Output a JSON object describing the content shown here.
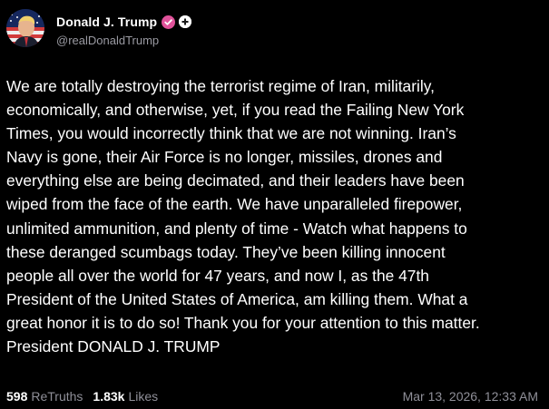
{
  "author": {
    "display_name": "Donald J. Trump",
    "handle": "@realDonaldTrump",
    "avatar_icon": "profile-avatar",
    "verified_icon": "verified-badge-icon",
    "verified_color": "#e0529a",
    "plus_icon": "plus-badge-icon"
  },
  "post": {
    "text": "We are totally destroying the terrorist regime of Iran, militarily,\neconomically, and otherwise, yet, if you read the Failing New York\nTimes, you would incorrectly think that we are not winning. Iran’s\nNavy is gone, their Air Force is no longer, missiles, drones and\neverything else are being decimated, and their leaders have been\nwiped from the face of the earth. We have unparalleled firepower,\nunlimited ammunition, and plenty of time - Watch what happens to\nthese deranged scumbags today. They’ve been killing innocent\npeople all over the world for 47 years, and now I, as the 47th\nPresident of the United States of America, am killing them. What a\ngreat honor it is to do so! Thank you for your attention to this matter.\nPresident DONALD J. TRUMP"
  },
  "stats": {
    "retruths_count": "598",
    "retruths_label": "ReTruths",
    "likes_count": "1.83k",
    "likes_label": "Likes"
  },
  "timestamp": "Mar 13, 2026, 12:33 AM",
  "colors": {
    "background": "#000000",
    "text_primary": "#ffffff",
    "text_secondary": "#8f8f98"
  }
}
